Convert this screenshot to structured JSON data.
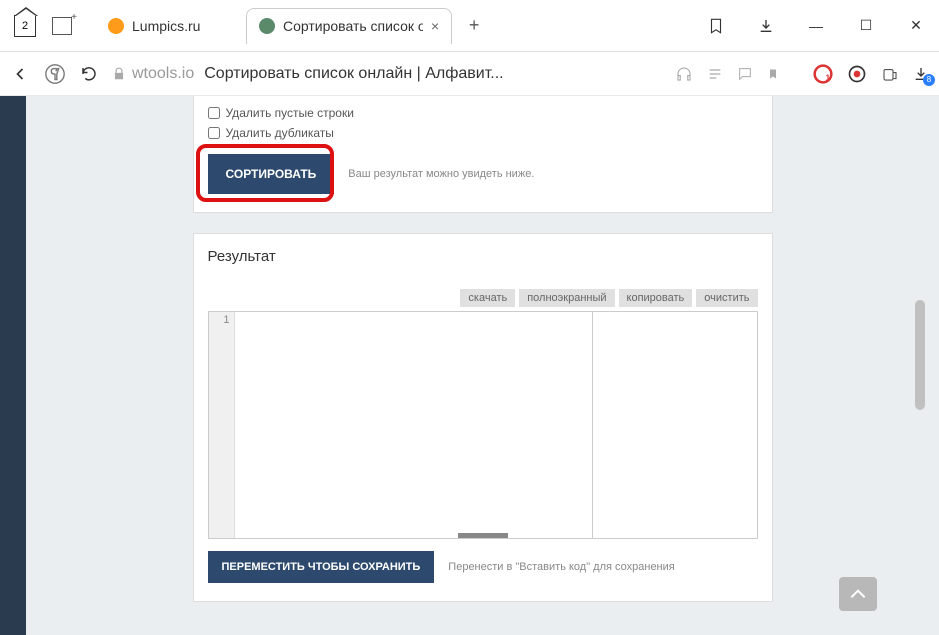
{
  "window": {
    "tab_count": "2"
  },
  "tabs": {
    "inactive": {
      "title": "Lumpics.ru",
      "favicon": "#ff9b1a"
    },
    "active": {
      "title": "Сортировать список он",
      "favicon": "#5a8a6a"
    }
  },
  "address": {
    "domain": "wtools.io",
    "title": "Сортировать список онлайн | Алфавит..."
  },
  "options": {
    "remove_empty": "Удалить пустые строки",
    "remove_dupes": "Удалить дубликаты"
  },
  "sort": {
    "button": "СОРТИРОВАТЬ",
    "hint": "Ваш результат можно увидеть ниже."
  },
  "result": {
    "heading": "Результат",
    "tools": {
      "download": "скачать",
      "fullscreen": "полноэкранный",
      "copy": "копировать",
      "clear": "очистить"
    },
    "line_no": "1"
  },
  "save": {
    "button": "ПЕРЕМЕСТИТЬ ЧТОБЫ СОХРАНИТЬ",
    "hint": "Перенести в \"Вставить код\" для сохранения"
  }
}
